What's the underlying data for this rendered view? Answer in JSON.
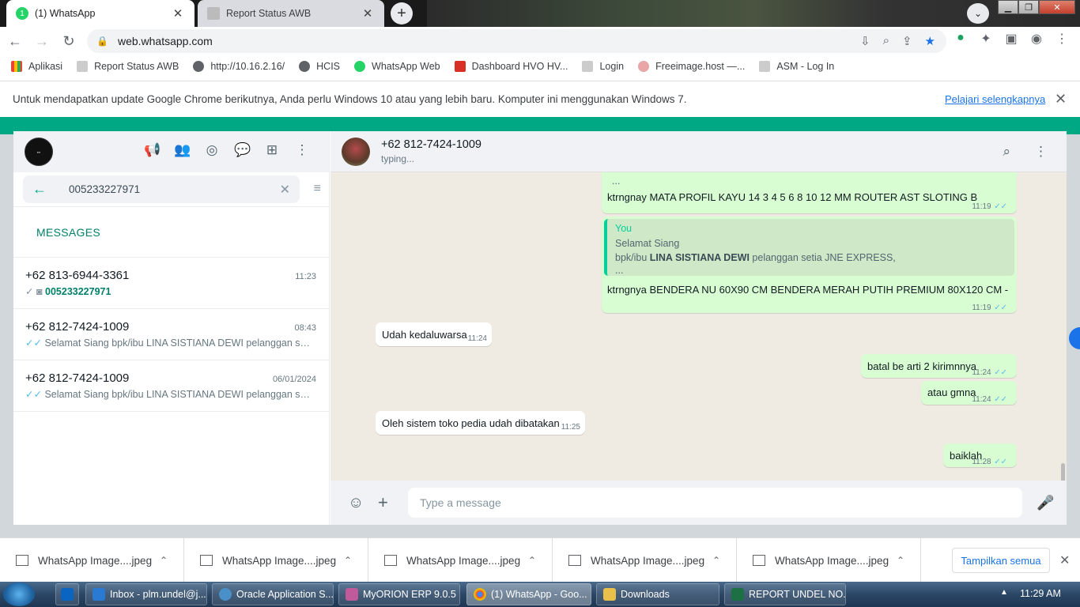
{
  "browser": {
    "tabs": [
      {
        "label": "(1) WhatsApp"
      },
      {
        "label": "Report Status AWB"
      }
    ],
    "url": "web.whatsapp.com",
    "bookmarks": [
      {
        "label": "Aplikasi"
      },
      {
        "label": "Report Status AWB"
      },
      {
        "label": "http://10.16.2.16/"
      },
      {
        "label": "HCIS"
      },
      {
        "label": "WhatsApp Web"
      },
      {
        "label": "Dashboard HVO HV..."
      },
      {
        "label": "Login"
      },
      {
        "label": "Freeimage.host —..."
      },
      {
        "label": "ASM - Log In"
      }
    ],
    "infobar": {
      "text": "Untuk mendapatkan update Google Chrome berikutnya, Anda perlu Windows 10 atau yang lebih baru. Komputer ini menggunakan Windows 7.",
      "link": "Pelajari selengkapnya"
    }
  },
  "whatsapp": {
    "search_query": "005233227971",
    "section_label": "MESSAGES",
    "results": [
      {
        "name": "+62 813-6944-3361",
        "time": "11:23",
        "preview": "005233227971"
      },
      {
        "name": "+62 812-7424-1009",
        "time": "08:43",
        "preview": "Selamat Siang   bpk/ibu LINA SISTIANA DEWI pelanggan set..."
      },
      {
        "name": "+62 812-7424-1009",
        "time": "06/01/2024",
        "preview": "Selamat Siang   bpk/ibu LINA SISTIANA DEWI pelanggan set..."
      }
    ],
    "chat": {
      "name": "+62 812-7424-1009",
      "status": "typing...",
      "messages": {
        "m1_ellipsis": "...",
        "m1_text": "ktrngnay MATA PROFIL KAYU 14 3 4 5 6 8 10 12 MM ROUTER AST SLOTING B",
        "m1_time": "11:19",
        "m2_quote_author": "You",
        "m2_quote_line1": "Selamat Siang",
        "m2_quote_line2_pre": " bpk/ibu ",
        "m2_quote_line2_bold": "LINA SISTIANA DEWI",
        "m2_quote_line2_post": " pelanggan setia JNE EXPRESS,",
        "m2_quote_line3": "...",
        "m2_text": "ktrngnya BENDERA NU 60X90 CM BENDERA MERAH PUTIH PREMIUM 80X120 CM -",
        "m2_time": "11:19",
        "m3_text": "Udah kedaluwarsa",
        "m3_time": "11:24",
        "m4_text": "batal be arti 2 kirimnnya",
        "m4_time": "11:24",
        "m5_text": "atau gmna",
        "m5_time": "11:24",
        "m6_text": "Oleh sistem toko pedia udah dibatakan",
        "m6_time": "11:25",
        "m7_text": "baiklah",
        "m7_time": "11:28"
      },
      "composer_placeholder": "Type a message"
    }
  },
  "downloads": {
    "items": [
      {
        "label": "WhatsApp Image....jpeg"
      },
      {
        "label": "WhatsApp Image....jpeg"
      },
      {
        "label": "WhatsApp Image....jpeg"
      },
      {
        "label": "WhatsApp Image....jpeg"
      },
      {
        "label": "WhatsApp Image....jpeg"
      }
    ],
    "show_all": "Tampilkan semua"
  },
  "taskbar": {
    "items": [
      {
        "label": "Inbox - plm.undel@j..."
      },
      {
        "label": "Oracle Application S..."
      },
      {
        "label": "MyORION ERP 9.0.5"
      },
      {
        "label": "(1) WhatsApp - Goo..."
      },
      {
        "label": "Downloads"
      },
      {
        "label": "REPORT UNDEL NO..."
      }
    ],
    "clock": "11:29 AM"
  },
  "colors": {
    "wa_green": "#00a884",
    "outgoing_bubble": "#d9fdd3",
    "chat_bg": "#efeae2",
    "link_blue": "#1a73e8",
    "read_tick": "#53bdeb"
  }
}
